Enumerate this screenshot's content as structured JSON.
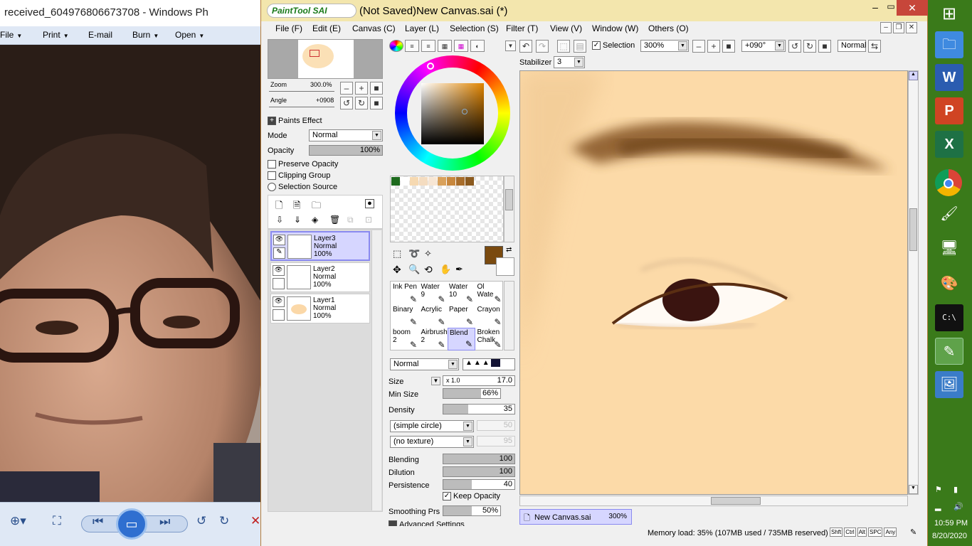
{
  "photo_viewer": {
    "title": "received_604976806673708 - Windows Ph",
    "menu": [
      {
        "label": "File",
        "dropdown": true
      },
      {
        "label": "Print",
        "dropdown": true
      },
      {
        "label": "E-mail",
        "dropdown": false
      },
      {
        "label": "Burn",
        "dropdown": true
      },
      {
        "label": "Open",
        "dropdown": true
      }
    ]
  },
  "sai": {
    "title": "(Not Saved)New Canvas.sai (*)",
    "logo": "PaintTool SAI",
    "menu": [
      "File (F)",
      "Edit (E)",
      "Canvas (C)",
      "Layer (L)",
      "Selection (S)",
      "Filter (T)",
      "View (V)",
      "Window (W)",
      "Others (O)"
    ],
    "navigator": {
      "zoom_label": "Zoom",
      "zoom_value": "300.0%",
      "angle_label": "Angle",
      "angle_value": "+0908"
    },
    "layer_props": {
      "paints_effect": "Paints Effect",
      "mode_label": "Mode",
      "mode_value": "Normal",
      "opacity_label": "Opacity",
      "opacity_value": "100%",
      "opacity_level": 1.0,
      "preserve_opacity": "Preserve Opacity",
      "clipping_group": "Clipping Group",
      "selection_source": "Selection Source"
    },
    "layers": [
      {
        "name": "Layer3",
        "mode": "Normal",
        "opacity": "100%",
        "active": true
      },
      {
        "name": "Layer2",
        "mode": "Normal",
        "opacity": "100%",
        "active": false
      },
      {
        "name": "Layer1",
        "mode": "Normal",
        "opacity": "100%",
        "active": false
      }
    ],
    "swatches": [
      "#1e6b1e",
      "#ffffff",
      "#f6d9b1",
      "#f4dcc0",
      "#f7e6d4",
      "#d9a15b",
      "#c8873d",
      "#a86d2b",
      "#8b5a1f"
    ],
    "primary_color": "#7a4a0f",
    "secondary_color": "#ffffff",
    "tools": [
      {
        "label": "Ink Pen",
        "num": ""
      },
      {
        "label": "Water",
        "num": "9"
      },
      {
        "label": "Water",
        "num": "10"
      },
      {
        "label": "Ol Wate",
        "num": ""
      },
      {
        "label": "Binary",
        "num": ""
      },
      {
        "label": "Acrylic",
        "num": ""
      },
      {
        "label": "Paper",
        "num": ""
      },
      {
        "label": "Crayon",
        "num": ""
      },
      {
        "label": "boom",
        "num": "2"
      },
      {
        "label": "Airbrush",
        "num": "2"
      },
      {
        "label": "Blend",
        "num": "",
        "active": true
      },
      {
        "label": "Broken Chalk",
        "num": ""
      }
    ],
    "brush": {
      "blend_mode": "Normal",
      "size_label": "Size",
      "size_mult": "x 1.0",
      "size_value": "17.0",
      "min_size_label": "Min Size",
      "min_size_value": "66%",
      "min_size_level": 0.66,
      "density_label": "Density",
      "density_value": "35",
      "density_level": 0.35,
      "shape": "(simple circle)",
      "shape_value": "50",
      "texture": "(no texture)",
      "texture_value": "95",
      "blending_label": "Blending",
      "blending_value": "100",
      "blending_level": 1.0,
      "dilution_label": "Dilution",
      "dilution_value": "100",
      "dilution_level": 1.0,
      "persistence_label": "Persistence",
      "persistence_value": "40",
      "persistence_level": 0.4,
      "keep_opacity": "Keep Opacity",
      "smoothing_label": "Smoothing Prs",
      "smoothing_value": "50%",
      "smoothing_level": 0.5,
      "advanced": "Advanced Settings"
    },
    "toolbar": {
      "selection_label": "Selection",
      "zoom": "300%",
      "angle": "+090°",
      "blend": "Normal",
      "stabilizer_label": "Stabilizer",
      "stabilizer_value": "3"
    },
    "canvas_tab": {
      "name": "New Canvas.sai",
      "zoom": "300%"
    },
    "status": {
      "memory": "Memory load: 35% (107MB used / 735MB reserved)",
      "keys": [
        "Shft",
        "Ctrl",
        "Alt",
        "SPC",
        "Any"
      ]
    }
  },
  "taskbar": {
    "time": "10:59 PM",
    "date": "8/20/2020",
    "apps": [
      "windows-start",
      "file-explorer",
      "word",
      "powerpoint",
      "excel",
      "chrome",
      "paint-tool",
      "remote-desktop",
      "paint",
      "command-prompt",
      "paint-tool-sai",
      "photo-viewer"
    ]
  }
}
